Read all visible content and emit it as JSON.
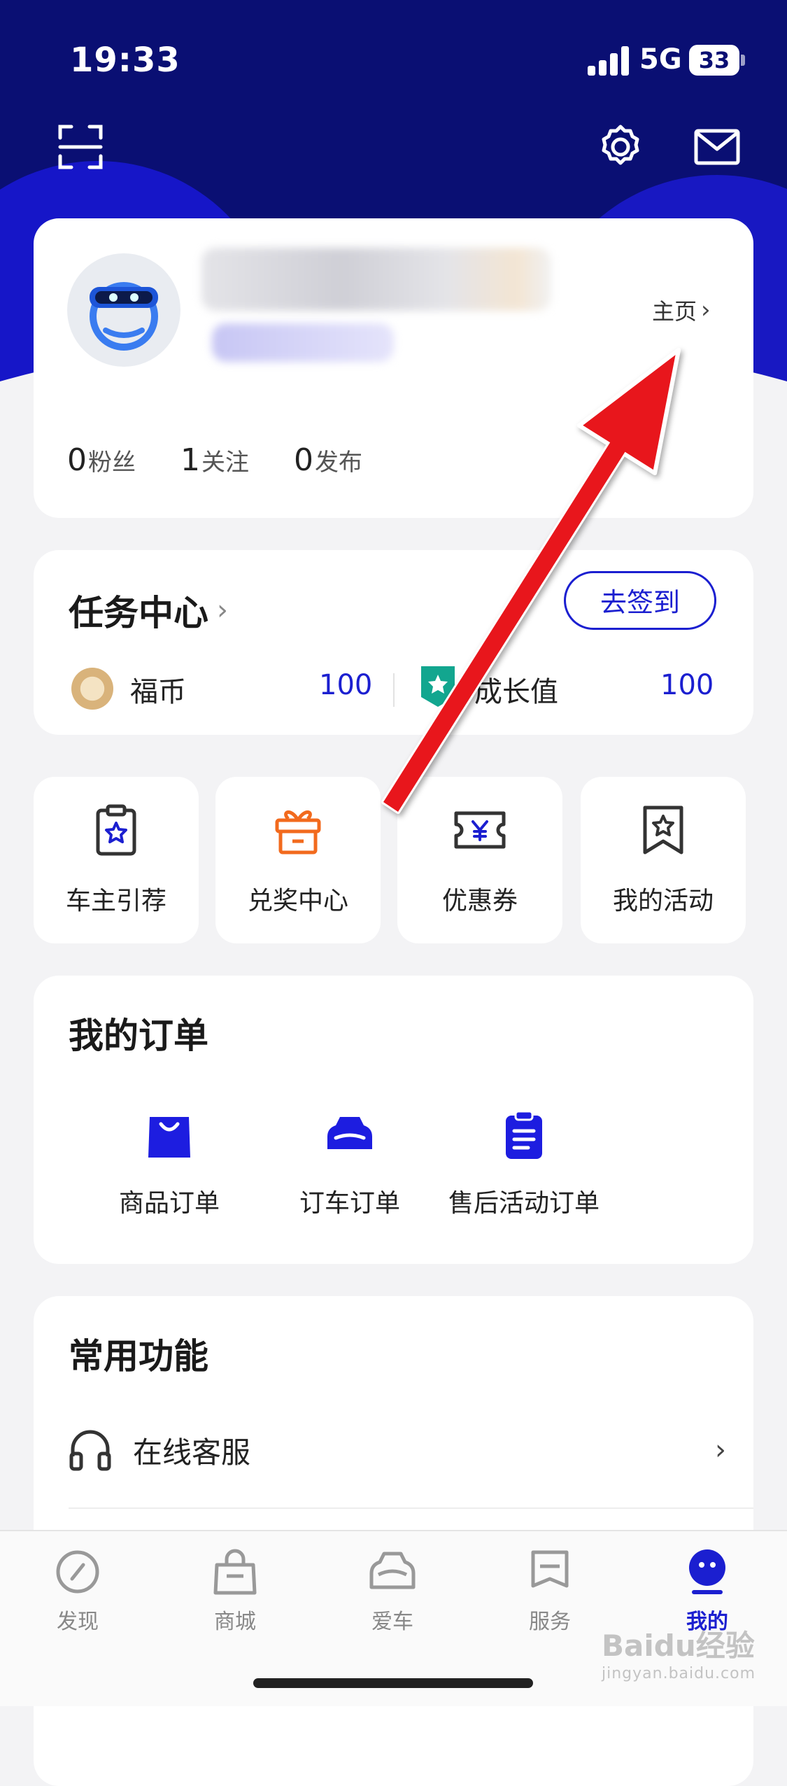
{
  "status": {
    "time": "19:33",
    "network": "5G",
    "battery": "33"
  },
  "profile": {
    "home_link": "主页",
    "stats": [
      {
        "num": "0",
        "label": "粉丝"
      },
      {
        "num": "1",
        "label": "关注"
      },
      {
        "num": "0",
        "label": "发布"
      }
    ]
  },
  "tasks": {
    "title": "任务中心",
    "checkin": "去签到",
    "fubi_label": "福币",
    "fubi_value": "100",
    "growth_label": "成长值",
    "growth_value": "100"
  },
  "tiles": [
    {
      "label": "车主引荐",
      "icon": "clipboard-star-icon"
    },
    {
      "label": "兑奖中心",
      "icon": "gift-box-icon"
    },
    {
      "label": "优惠券",
      "icon": "coupon-yen-icon"
    },
    {
      "label": "我的活动",
      "icon": "bookmark-star-icon"
    }
  ],
  "orders": {
    "title": "我的订单",
    "items": [
      {
        "label": "商品订单",
        "icon": "shopping-bag-icon"
      },
      {
        "label": "订车订单",
        "icon": "car-icon"
      },
      {
        "label": "售后活动订单",
        "icon": "clipboard-list-icon"
      }
    ]
  },
  "common": {
    "title": "常用功能",
    "items": [
      {
        "label": "在线客服",
        "icon": "headset-icon"
      }
    ]
  },
  "tabs": [
    {
      "label": "发现",
      "icon": "compass-icon"
    },
    {
      "label": "商城",
      "icon": "shopping-bag-icon"
    },
    {
      "label": "爱车",
      "icon": "car-front-icon"
    },
    {
      "label": "服务",
      "icon": "service-icon"
    },
    {
      "label": "我的",
      "icon": "profile-face-icon"
    }
  ],
  "watermark": {
    "brand": "Baidu经验",
    "url": "jingyan.baidu.com"
  },
  "colors": {
    "accent": "#1b1fd0",
    "hero": "#0a0f73",
    "annotation_arrow": "#e8141c"
  }
}
